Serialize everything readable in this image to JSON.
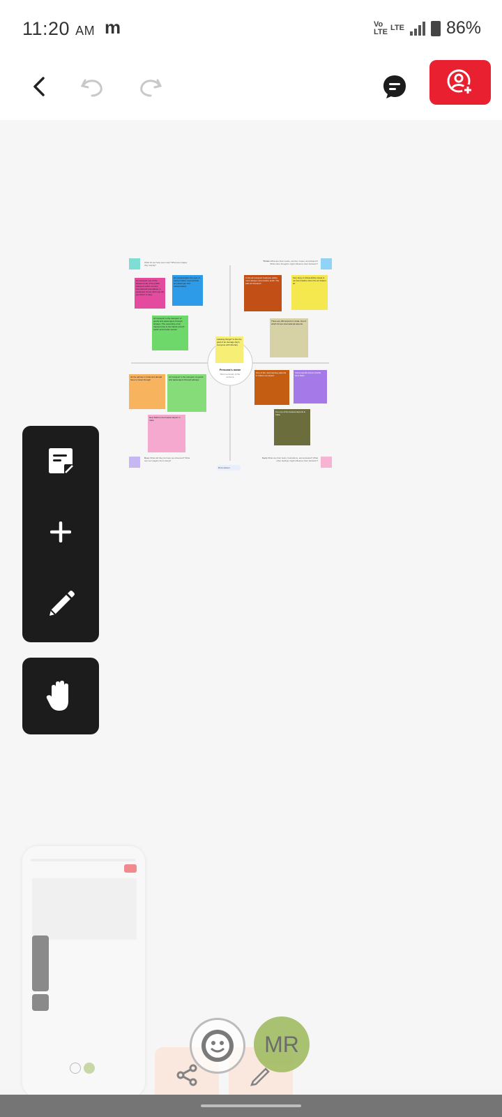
{
  "status": {
    "time": "11:20",
    "ampm": "AM",
    "carrier_glyph": "m",
    "net1": "Vo LTE",
    "net2": "LTE",
    "battery": "86%"
  },
  "toolbar": {
    "back_icon": "chevron-left-icon",
    "undo_icon": "undo-icon",
    "redo_icon": "redo-icon",
    "comment_icon": "comment-icon",
    "share_icon": "add-user-icon",
    "accent": "#e8202f"
  },
  "board": {
    "center_title": "Persona's name",
    "center_sub": "Short summary of the persona",
    "center_note": "Labeling things? Is this the goal of an average day's everyone with itinerary",
    "quadrants": [
      {
        "title": "",
        "lines": "What do we have seen say? What are images they saying?"
      },
      {
        "title": "Thinks",
        "lines": "What are their needs, worries, hopes, and dreams? What other thoughts might influence their behavior?"
      },
      {
        "title": "Does",
        "lines": "What did they do have we observed? What can we imagine them doing?"
      },
      {
        "title": "Feels",
        "lines": "What are their fears, frustrations, and anxieties? What other feelings might influence their behavior?"
      }
    ],
    "notes": [
      "Air transport one of the fastest mode of the public transport which connect international boundaries. A seasoned corner pilot may tell you that it is easy",
      "Air transportation the type of transportation used aircraft, air passenger and transportation",
      "Air transport is the transport of goods and passengers through airways. The ownership of air transport lies in the hands of both public and private sectors",
      "In the air transport business safety must always come before profit. The safe air transport",
      "Very busy in China Airline travel is not low timeline when the air shares air",
      "There are 463 airports in India. Out of which 34 are international airports",
      "Air transport is the transport of goods and passengers through airways",
      "All the airlines in India and abroad have to travel through",
      "One of the most low-key airports in India is an airport",
      "Indira Gandhi Airport (Delhi) New Delhi",
      "New Delhi is the busiest airport in India",
      "It is one of the busiest airports in India"
    ],
    "zoom_label": "Fit to screen"
  },
  "tools": {
    "sticky_icon": "sticky-note-icon",
    "add_icon": "plus-icon",
    "pen_icon": "pencil-icon",
    "hand_icon": "hand-icon"
  },
  "bottom": {
    "avatar_initials": "MR",
    "share_icon": "share-icon",
    "edit_icon": "edit-icon",
    "emoji_icon": "emoji-icon"
  }
}
